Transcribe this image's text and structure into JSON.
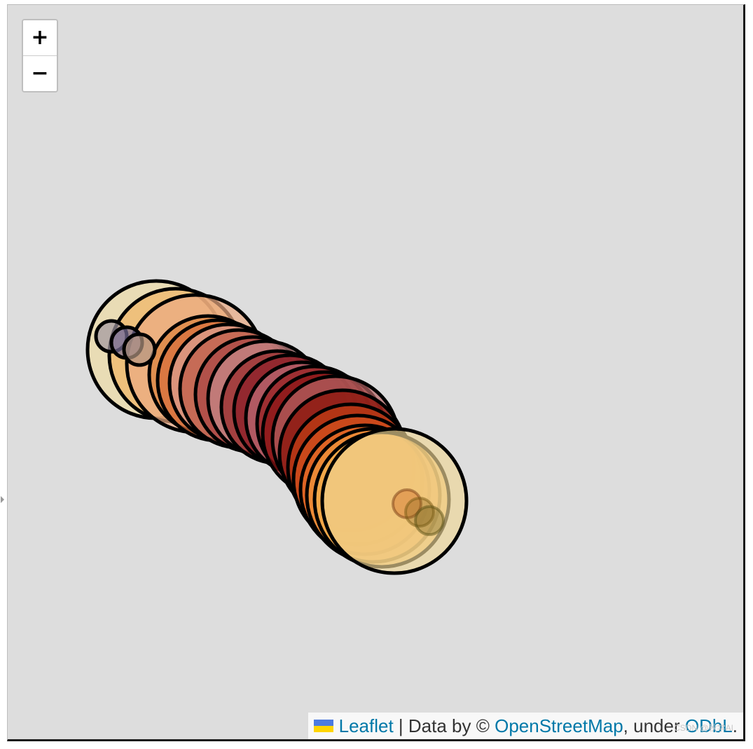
{
  "map": {
    "zoom_in_label": "+",
    "zoom_out_label": "−"
  },
  "attribution": {
    "leaflet_label": "Leaflet",
    "separator": " | Data by © ",
    "osm_label": "OpenStreetMap",
    "under_text": ", under ",
    "odbl_label": "ODbL",
    "period": "."
  },
  "watermark": "CSDN @秋学AI",
  "colors": {
    "background": "#dddddd",
    "link": "#0078a8",
    "stroke": "#000000"
  }
}
